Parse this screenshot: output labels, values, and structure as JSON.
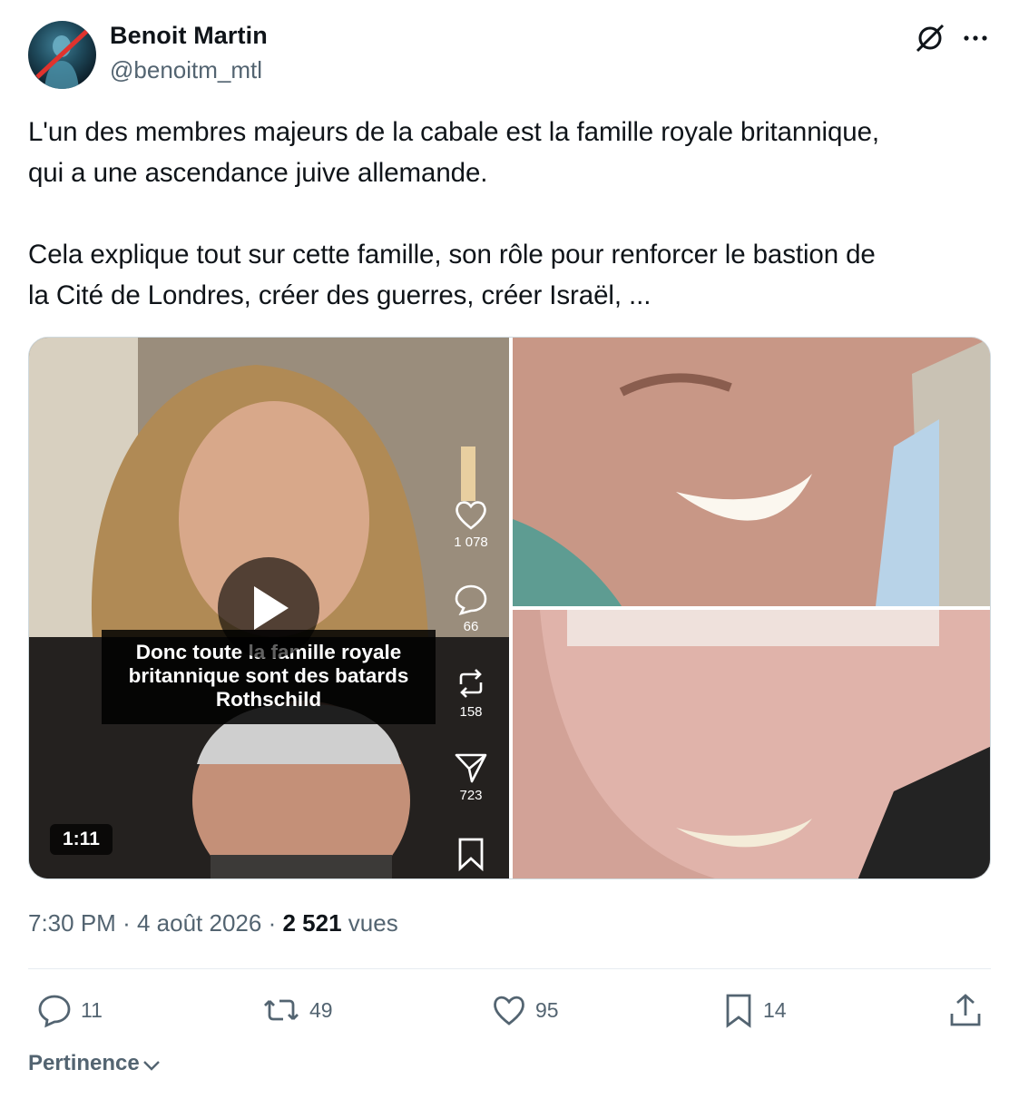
{
  "author": {
    "display_name": "Benoit Martin",
    "handle": "@benoitm_mtl"
  },
  "tweet": {
    "text": "L'un des membres majeurs de la cabale est la famille royale britannique,\nqui a une ascendance juive allemande.\n\nCela explique tout sur cette famille, son rôle pour renforcer le bastion de\nla Cité de Londres, créer des guerres, créer Israël, ..."
  },
  "video": {
    "caption": "Donc toute la famille royale britannique sont des batards Rothschild",
    "duration": "1:11",
    "overlay_counts": {
      "likes": "1 078",
      "comments": "66",
      "reposts": "158",
      "shares": "723"
    }
  },
  "meta": {
    "time": "7:30 PM",
    "separator": "·",
    "date": "4 août 2026",
    "views_count": "2 521",
    "views_label": "vues"
  },
  "actions": {
    "replies": "11",
    "reposts": "49",
    "likes": "95",
    "bookmarks": "14"
  },
  "sort": {
    "label": "Pertinence"
  },
  "icons": [
    "grok-icon",
    "more-icon",
    "play-icon",
    "heart-icon",
    "comment-icon",
    "repost-icon",
    "share-icon",
    "bookmark-icon",
    "reply-icon",
    "like-icon",
    "upload-icon",
    "chevron-down-icon"
  ],
  "colors": {
    "text": "#0f1419",
    "secondary": "#536471",
    "divider": "#e6ecf0"
  }
}
